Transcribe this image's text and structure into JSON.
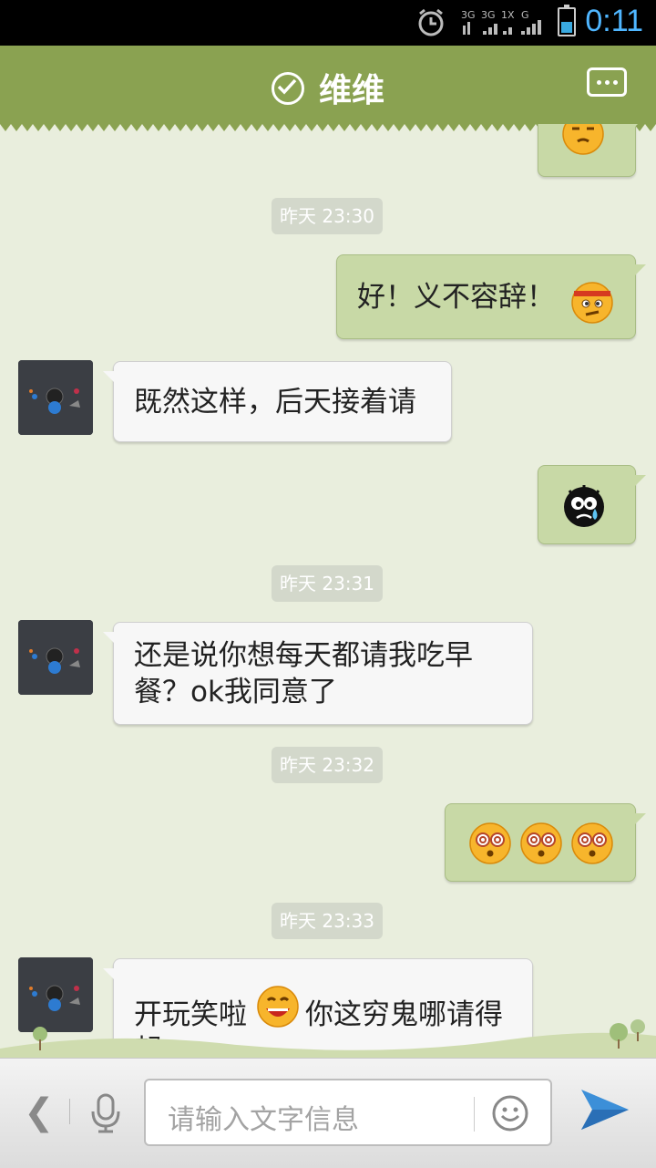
{
  "status_bar": {
    "time": "0:11",
    "network_label": "3G 3G 1X G",
    "colors": {
      "clock": "#4fb6ff",
      "battery": "#39a9e0"
    }
  },
  "header": {
    "title": "维维",
    "verified_icon": "check-circle-icon",
    "menu_icon": "more-options-icon",
    "color": "#8aa251"
  },
  "messages": [
    {
      "type": "emoji-only",
      "side": "me",
      "emojis": [
        "annoyed-face-icon"
      ]
    },
    {
      "type": "timestamp",
      "text": "昨天 23:30"
    },
    {
      "type": "text",
      "side": "me",
      "text": "好！义不容辞！",
      "trailing_emoji": "determined-face-icon"
    },
    {
      "type": "text",
      "side": "them",
      "text": "既然这样，后天接着请"
    },
    {
      "type": "emoji-only",
      "side": "me",
      "emojis": [
        "crying-black-face-icon"
      ]
    },
    {
      "type": "timestamp",
      "text": "昨天 23:31"
    },
    {
      "type": "text",
      "side": "them",
      "line1": "还是说你想每天都请我吃早",
      "line2": "餐？ok我同意了"
    },
    {
      "type": "timestamp",
      "text": "昨天 23:32"
    },
    {
      "type": "emoji-only",
      "side": "me",
      "emojis": [
        "dizzy-face-icon",
        "dizzy-face-icon",
        "dizzy-face-icon"
      ]
    },
    {
      "type": "timestamp",
      "text": "昨天 23:33"
    },
    {
      "type": "text",
      "side": "them",
      "part1": "开玩笑啦",
      "emoji": "grinning-face-icon",
      "part2": "你这穷鬼哪请得",
      "line2": "起"
    }
  ],
  "input_bar": {
    "placeholder": "请输入文字信息",
    "back_icon": "chevron-left-icon",
    "voice_icon": "microphone-icon",
    "emoji_icon": "smiley-icon",
    "send_icon": "send-icon"
  }
}
